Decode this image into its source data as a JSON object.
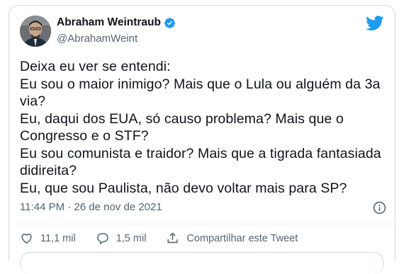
{
  "user": {
    "display_name": "Abraham Weintraub",
    "handle": "@AbrahamWeint"
  },
  "tweet": {
    "text": "Deixa eu ver se entendi:\nEu sou o maior inimigo? Mais que o Lula ou alguém da 3a via?\nEu, daqui dos EUA, só causo problema? Mais que o Congresso e o STF?\nEu sou comunista e traidor? Mais que a tigrada fantasiada didireita?\nEu, que sou Paulista, não devo voltar mais para SP?",
    "timestamp": "11:44 PM · 26 de nov de 2021"
  },
  "actions": {
    "likes": "11,1 mil",
    "replies": "1,5 mil",
    "share_label": "Compartilhar este Tweet"
  },
  "colors": {
    "brand": "#1d9bf0",
    "text": "#0f1419",
    "secondary": "#536471"
  },
  "icons": [
    "verified-badge-icon",
    "twitter-bird-icon",
    "info-icon",
    "heart-icon",
    "reply-icon",
    "share-icon"
  ]
}
